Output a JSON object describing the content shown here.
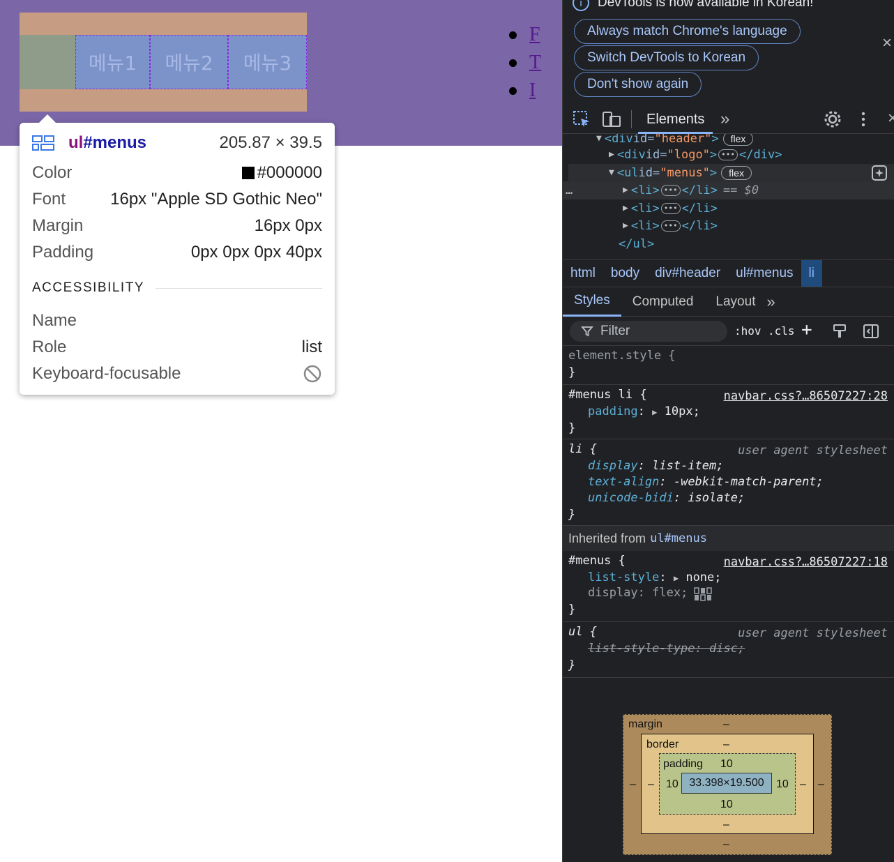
{
  "page": {
    "menus": [
      "메뉴1",
      "메뉴2",
      "메뉴3"
    ],
    "icon_links": [
      "F",
      "T",
      "I"
    ]
  },
  "tooltip": {
    "selector_tag": "ul",
    "selector_id": "#menus",
    "size": "205.87 × 39.5",
    "rows": [
      {
        "key": "Color",
        "value": "#000000"
      },
      {
        "key": "Font",
        "value": "16px \"Apple SD Gothic Neo\""
      },
      {
        "key": "Margin",
        "value": "16px 0px"
      },
      {
        "key": "Padding",
        "value": "0px 0px 0px 40px"
      }
    ],
    "accessibility_header": "ACCESSIBILITY",
    "acc_rows": [
      {
        "key": "Name",
        "value": ""
      },
      {
        "key": "Role",
        "value": "list"
      },
      {
        "key": "Keyboard-focusable",
        "value": ""
      }
    ],
    "icon": "flex-layout-icon",
    "not-focusable-icon": "circle-slash-icon"
  },
  "devtools": {
    "infobar": {
      "message": "DevTools is now available in Korean!",
      "buttons": [
        "Always match Chrome's language",
        "Switch DevTools to Korean",
        "Don't show again"
      ],
      "close": "×"
    },
    "main_tab": "Elements",
    "more_tabs": "»",
    "dom": {
      "line0_tag": "<div",
      "line0_attr": " id=",
      "line0_val": "\"header\"",
      "line0_close": ">",
      "line0_badge": "flex",
      "line1_open": "<div",
      "line1_attr": " id=",
      "line1_val": "\"logo\"",
      "line1_mid": ">",
      "line1_close": "</div>",
      "line2_open": "<ul",
      "line2_attr": " id=",
      "line2_val": "\"menus\"",
      "line2_close": ">",
      "line2_badge": "flex",
      "li_open": "<li>",
      "li_close": "</li>",
      "selected_marker": "== $0",
      "ul_close": "</ul>",
      "ellipsis": "…"
    },
    "breadcrumb": [
      "html",
      "body",
      "div#header",
      "ul#menus",
      "li"
    ],
    "subtabs": [
      "Styles",
      "Computed",
      "Layout"
    ],
    "subtabs_more": "»",
    "filter_placeholder": "Filter",
    "hov": ":hov",
    "cls": ".cls",
    "styles": {
      "element_style": "element.style {",
      "close": "}",
      "rule1_selector": "#menus li {",
      "rule1_source": "navbar.css?…86507227:28",
      "rule1_prop": "padding",
      "rule1_val": "10px;",
      "rule2_selector": "li {",
      "rule2_source": "user agent stylesheet",
      "rule2_props": [
        {
          "prop": "display",
          "val": "list-item;"
        },
        {
          "prop": "text-align",
          "val": "-webkit-match-parent;"
        },
        {
          "prop": "unicode-bidi",
          "val": "isolate;"
        }
      ],
      "inherited_label": "Inherited from",
      "inherited_from": "ul#menus",
      "rule3_selector": "#menus {",
      "rule3_source": "navbar.css?…86507227:18",
      "rule3_prop1": "list-style",
      "rule3_val1": "none;",
      "rule3_prop2": "display",
      "rule3_val2": "flex;",
      "rule4_selector": "ul {",
      "rule4_source": "user agent stylesheet",
      "rule4_prop": "list-style-type",
      "rule4_val": "disc;"
    },
    "boxmodel": {
      "margin_label": "margin",
      "border_label": "border",
      "padding_label": "padding",
      "dash": "–",
      "padding_top": "10",
      "padding_left": "10",
      "padding_right": "10",
      "padding_bottom": "10",
      "content": "33.398×19.500"
    }
  }
}
